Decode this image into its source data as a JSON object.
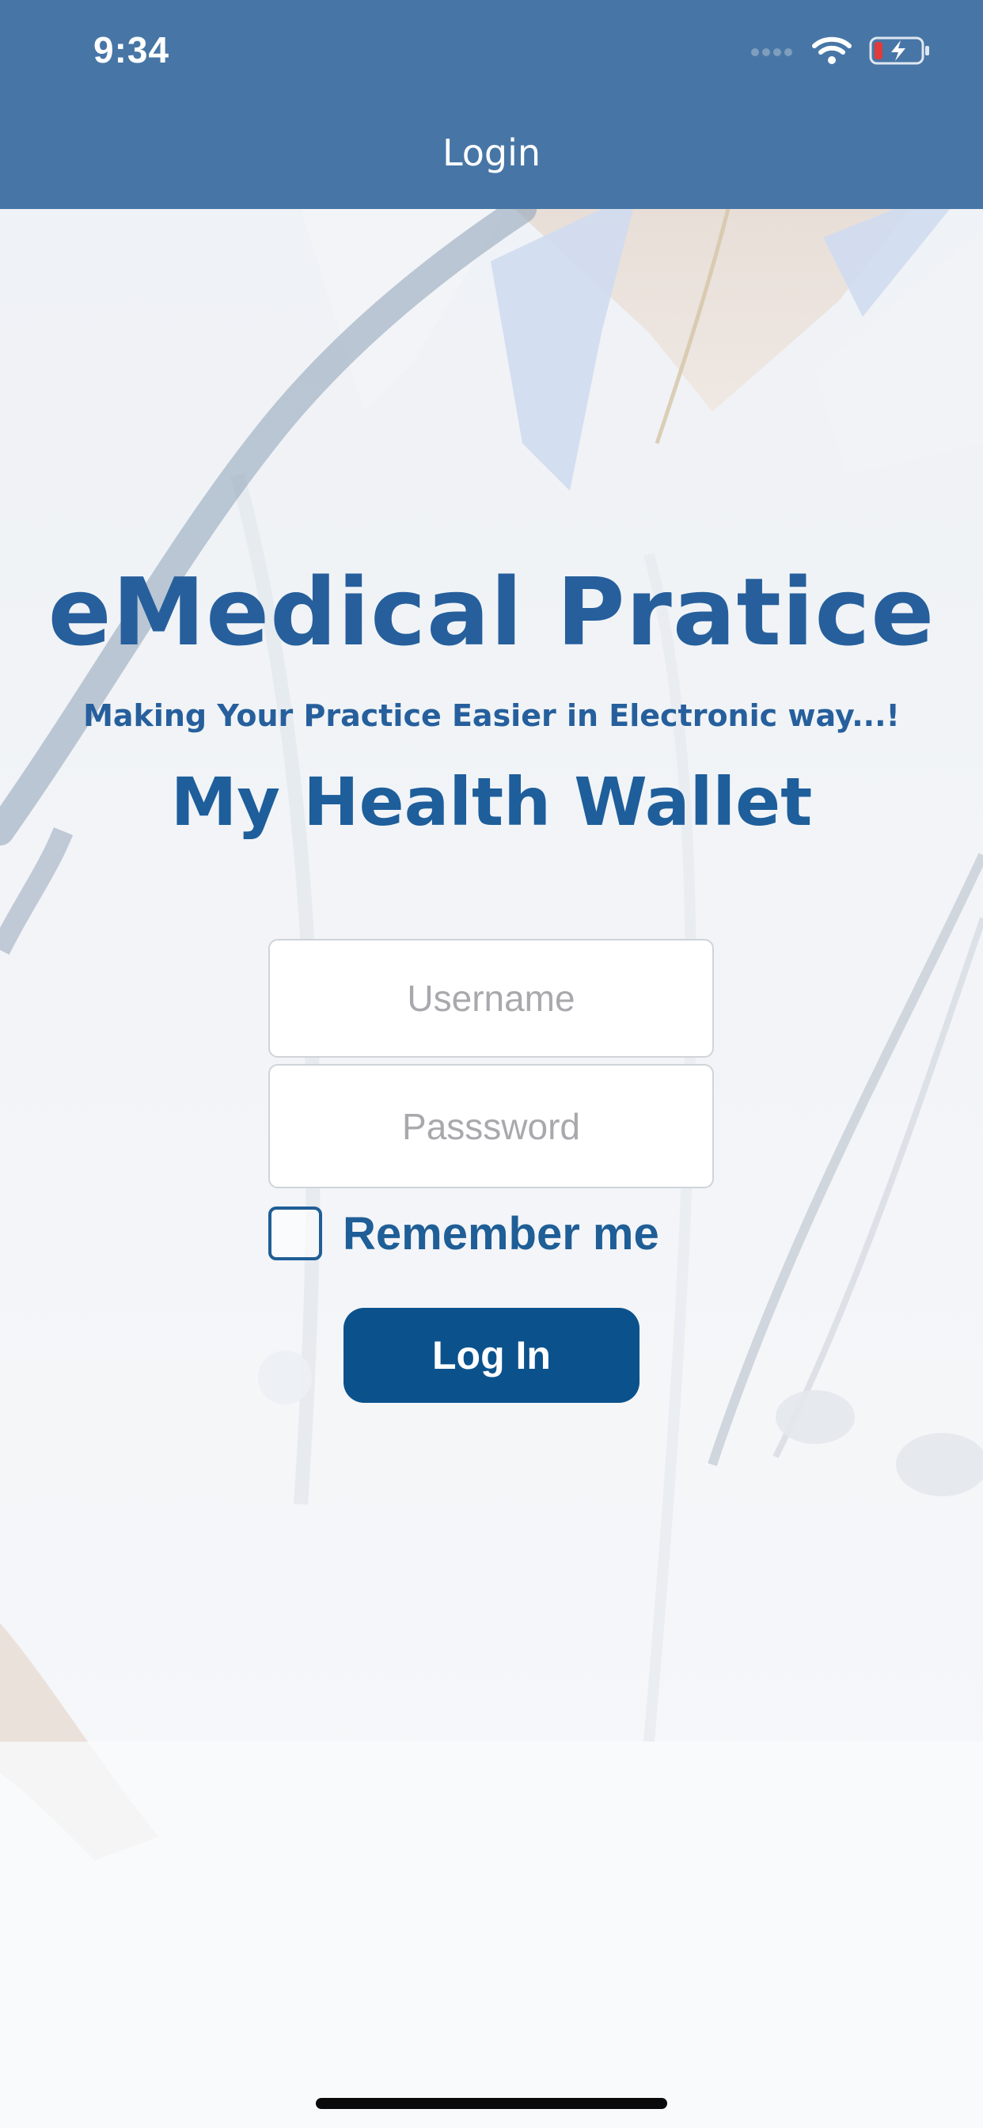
{
  "status_bar": {
    "time": "9:34",
    "icons": [
      "signal-dots-icon",
      "wifi-icon",
      "battery-charging-icon"
    ]
  },
  "nav": {
    "title": "Login"
  },
  "header": {
    "app_title": "eMedical Pratice",
    "tagline": "Making Your Practice Easier in Electronic way...!",
    "subtitle": "My Health Wallet"
  },
  "form": {
    "username_placeholder": "Username",
    "username_value": "",
    "password_placeholder": "Passsword",
    "password_value": "",
    "remember_label": "Remember me",
    "remember_checked": false,
    "login_label": "Log In"
  },
  "colors": {
    "top_bar": "#4776a6",
    "brand_blue": "#265f9c",
    "button": "#0b528d"
  }
}
